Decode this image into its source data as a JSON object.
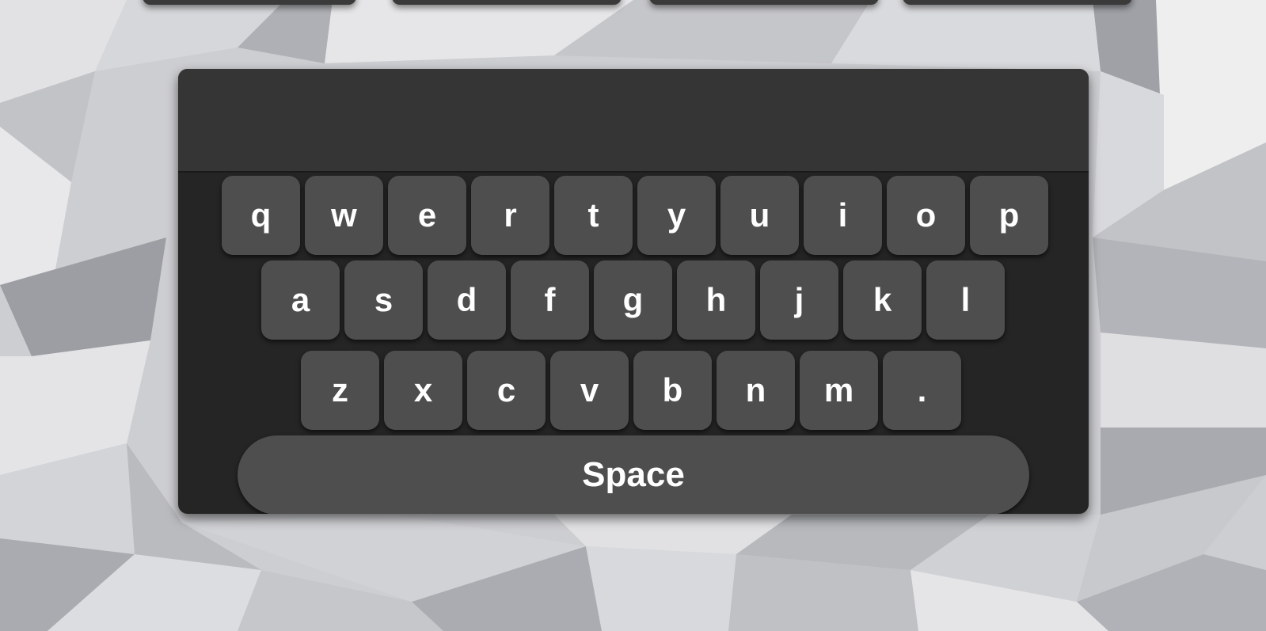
{
  "keyboard": {
    "text_value": "",
    "rows": [
      [
        "q",
        "w",
        "e",
        "r",
        "t",
        "y",
        "u",
        "i",
        "o",
        "p"
      ],
      [
        "a",
        "s",
        "d",
        "f",
        "g",
        "h",
        "j",
        "k",
        "l"
      ],
      [
        "z",
        "x",
        "c",
        "v",
        "b",
        "n",
        "m",
        "."
      ]
    ],
    "space_label": "Space"
  },
  "colors": {
    "key_bg": "#4e4e4e",
    "panel_bg": "#252525",
    "display_bg": "#353535",
    "key_text": "#ffffff"
  }
}
